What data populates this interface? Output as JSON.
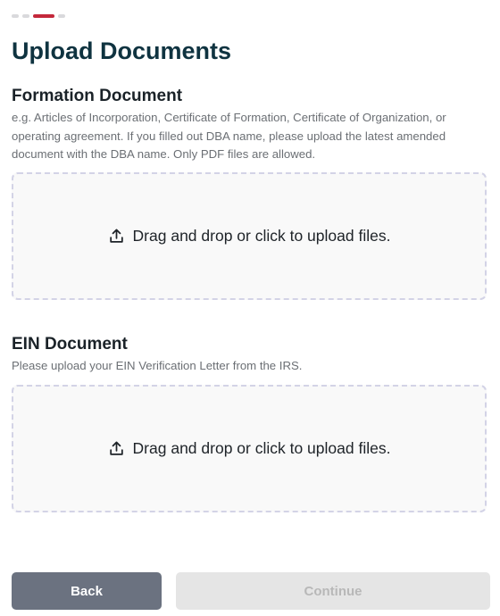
{
  "progress": {
    "current_step": 3,
    "total_steps": 4
  },
  "page_title": "Upload Documents",
  "sections": [
    {
      "title": "Formation Document",
      "description": "e.g. Articles of Incorporation, Certificate of Formation, Certificate of Organization, or operating agreement. If you filled out DBA name, please upload the latest amended document with the DBA name. Only PDF files are allowed.",
      "dropzone_label": "Drag and drop or click to upload files.",
      "dropzone_icon": "upload-icon"
    },
    {
      "title": "EIN Document",
      "description": "Please upload your EIN Verification Letter from the IRS.",
      "dropzone_label": "Drag and drop or click to upload files.",
      "dropzone_icon": "upload-icon"
    }
  ],
  "footer": {
    "back_label": "Back",
    "continue_label": "Continue",
    "continue_disabled": true
  },
  "colors": {
    "accent": "#c4283b",
    "title": "#0f3340",
    "back_button": "#6b7280",
    "continue_disabled": "#e5e5e5",
    "dropzone_border": "#d3d3e6"
  }
}
